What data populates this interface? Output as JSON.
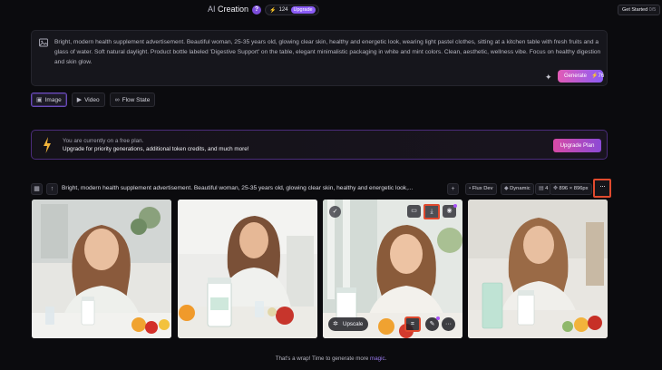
{
  "header": {
    "title_prefix": "AI",
    "title_rest": " Creation",
    "help_glyph": "?",
    "credits": "124",
    "upgrade_label": "Upgrade",
    "get_started_label": "Get Started",
    "get_started_count": "0/5"
  },
  "prompt": {
    "text": "Bright, modern health supplement advertisement. Beautiful woman, 25-35 years old, glowing clear skin, healthy and energetic look, wearing light pastel clothes, sitting at a kitchen table with fresh fruits and a glass of water. Soft natural daylight. Product bottle labeled 'Digestive Support' on the table, elegant minimalistic packaging in white and mint colors. Clean, aesthetic, wellness vibe. Focus on healthy digestion and skin glow.",
    "generate_label": "Generate",
    "generate_cost": "76"
  },
  "tabs": [
    {
      "label": "Image",
      "icon": "image-icon",
      "active": true
    },
    {
      "label": "Video",
      "icon": "video-icon",
      "active": false
    },
    {
      "label": "Flow State",
      "icon": "infinity-icon",
      "active": false
    }
  ],
  "banner": {
    "line1": "You are currently on a free plan.",
    "line2": "Upgrade for priority generations, additional token credits, and much more!",
    "button": "Upgrade Plan"
  },
  "generation": {
    "prompt_preview": "Bright, modern health supplement advertisement. Beautiful woman, 25-35 years old, glowing clear skin, healthy and energetic look,...",
    "model": "Flux Dev",
    "style": "Dynamic",
    "count": "4",
    "size": "896 × 896px",
    "more_glyph": "···"
  },
  "card3": {
    "upscale_label": "Upscale"
  },
  "footer": {
    "text": "That's a wrap! Time to generate more ",
    "link": "magic",
    "end": "."
  },
  "colors": {
    "accent": "#8b5cf6",
    "highlight": "#e04a2e",
    "background": "#0b0b0e"
  }
}
